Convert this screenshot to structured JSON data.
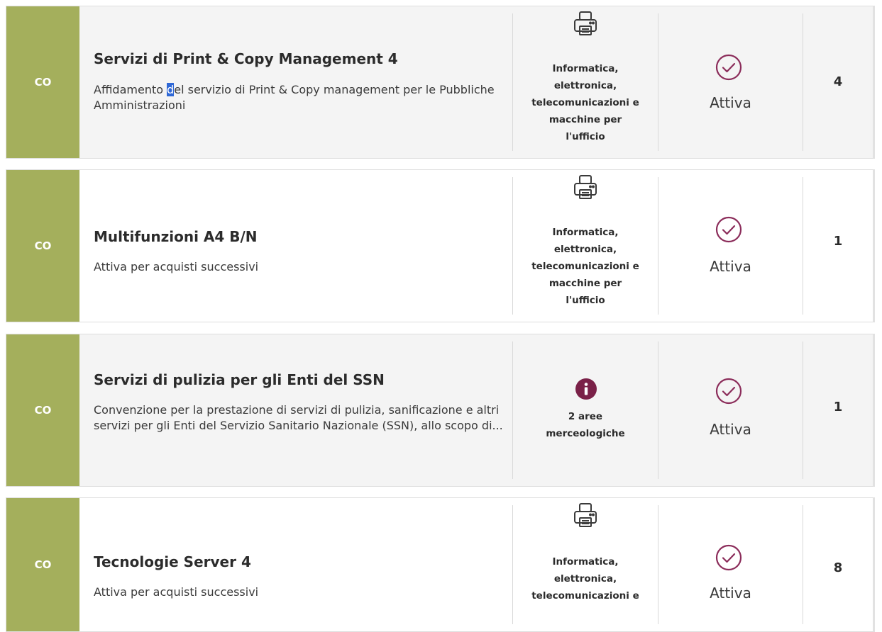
{
  "colors": {
    "tag_bg": "#a4af5c",
    "accent": "#8b2c5a",
    "selection": "#2f68d6"
  },
  "rows": [
    {
      "tag": "CO",
      "title": "Servizi di Print & Copy Management 4",
      "desc_before": "Affidamento ",
      "desc_selected": "d",
      "desc_after": "el servizio di Print & Copy management per le Pubbliche Amministrazioni",
      "category": {
        "icon": "printer-icon",
        "lines": [
          "Informatica,",
          "elettronica,",
          "telecomunicazioni e",
          "macchine per",
          "l'ufficio"
        ]
      },
      "status": {
        "icon": "check-circle-icon",
        "label": "Attiva"
      },
      "count": "4"
    },
    {
      "tag": "CO",
      "title": "Multifunzioni A4 B/N",
      "desc": "Attiva per acquisti successivi",
      "category": {
        "icon": "printer-icon",
        "lines": [
          "Informatica,",
          "elettronica,",
          "telecomunicazioni e",
          "macchine per",
          "l'ufficio"
        ]
      },
      "status": {
        "icon": "check-circle-icon",
        "label": "Attiva"
      },
      "count": "1"
    },
    {
      "tag": "CO",
      "title": "Servizi di pulizia per gli Enti del SSN",
      "desc": "Convenzione per la prestazione di servizi di pulizia, sanificazione e altri servizi per gli Enti del Servizio Sanitario Nazionale (SSN), allo scopo di...",
      "category": {
        "icon": "info-icon",
        "lines": [
          "2 aree",
          "merceologiche"
        ]
      },
      "status": {
        "icon": "check-circle-icon",
        "label": "Attiva"
      },
      "count": "1"
    },
    {
      "tag": "CO",
      "title": "Tecnologie Server 4",
      "desc": "Attiva per acquisti successivi",
      "category": {
        "icon": "printer-icon",
        "lines": [
          "Informatica,",
          "elettronica,",
          "telecomunicazioni e"
        ]
      },
      "status": {
        "icon": "check-circle-icon",
        "label": "Attiva"
      },
      "count": "8"
    }
  ]
}
